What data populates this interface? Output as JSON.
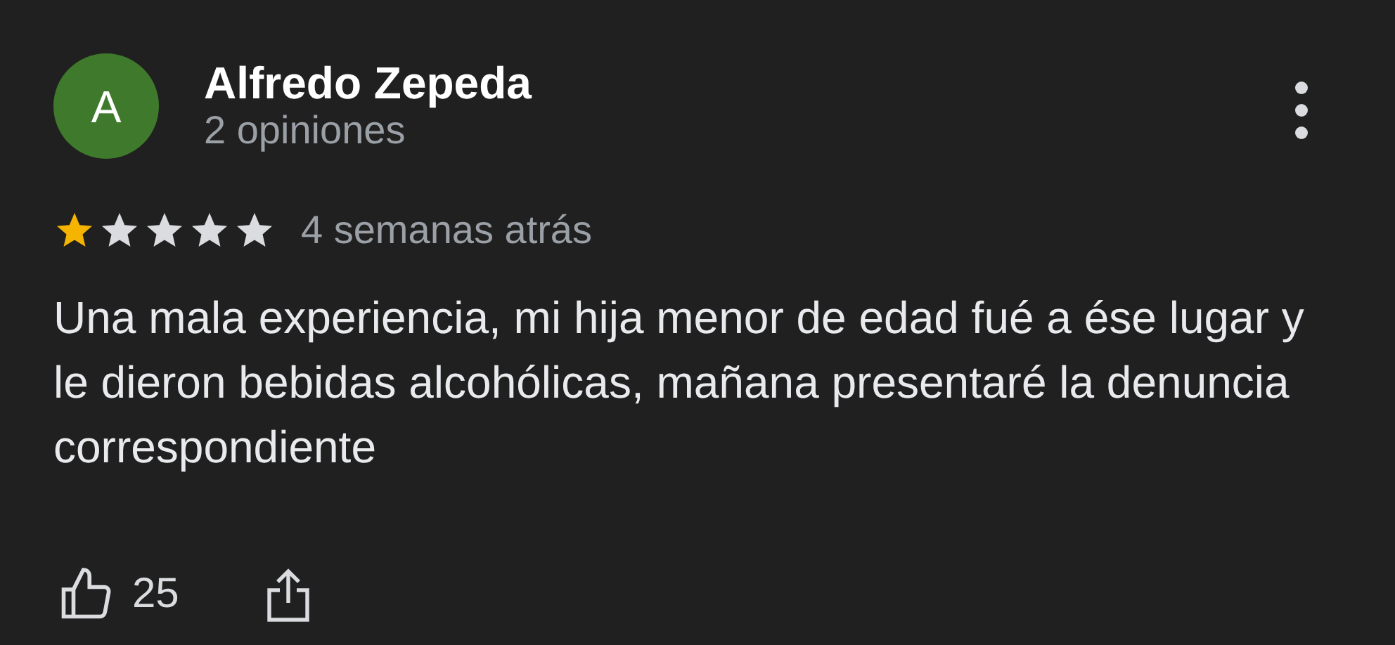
{
  "review": {
    "avatar_letter": "A",
    "author": "Alfredo Zepeda",
    "review_count": "2 opiniones",
    "stars": 1,
    "time": "4 semanas atrás",
    "text": "Una mala experiencia, mi hija menor de edad fué a ése lugar y le dieron bebidas alcohólicas, mañana presentaré la denuncia correspondiente",
    "likes": "25"
  }
}
